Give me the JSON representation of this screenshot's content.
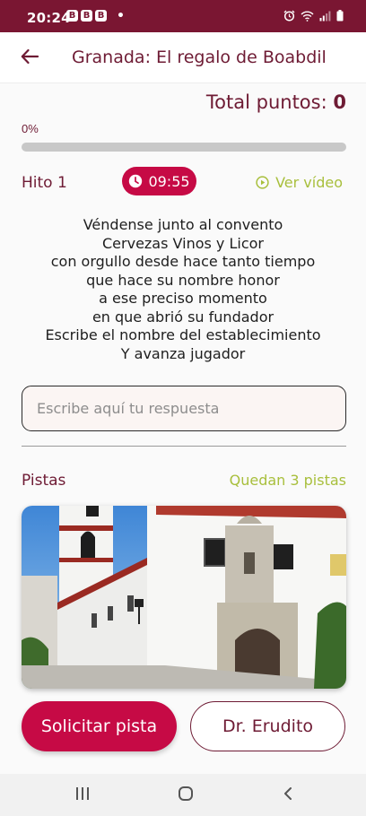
{
  "status_bar": {
    "time": "20:24",
    "badges": [
      "B",
      "B",
      "B"
    ],
    "dot": "•",
    "icons": [
      "alarm-icon",
      "wifi-icon",
      "signal-icon",
      "battery-icon"
    ]
  },
  "header": {
    "back_icon": "arrow-left-icon",
    "title": "Granada: El regalo de Boabdil"
  },
  "score": {
    "label": "Total puntos:",
    "value": "0"
  },
  "progress": {
    "label": "0%",
    "value": 0
  },
  "milestone": {
    "label": "Hito 1",
    "timer": "09:55",
    "video_label": "Ver vídeo"
  },
  "riddle": {
    "lines": [
      "Véndense junto al convento",
      "Cervezas Vinos y Licor",
      "con orgullo desde hace tanto tiempo",
      "que hace su nombre honor",
      "a ese preciso momento",
      "en que abrió su fundador",
      "Escribe el nombre del establecimiento",
      "Y avanza jugador"
    ]
  },
  "answer": {
    "value": "",
    "placeholder": "Escribe aquí tu respuesta"
  },
  "hints": {
    "label": "Pistas",
    "remaining": "Quedan 3 pistas"
  },
  "actions": {
    "request_hint": "Solicitar pista",
    "expert": "Dr. Erudito"
  },
  "colors": {
    "brand": "#7a1632",
    "accent": "#c60a45",
    "green": "#a8bf3c"
  }
}
